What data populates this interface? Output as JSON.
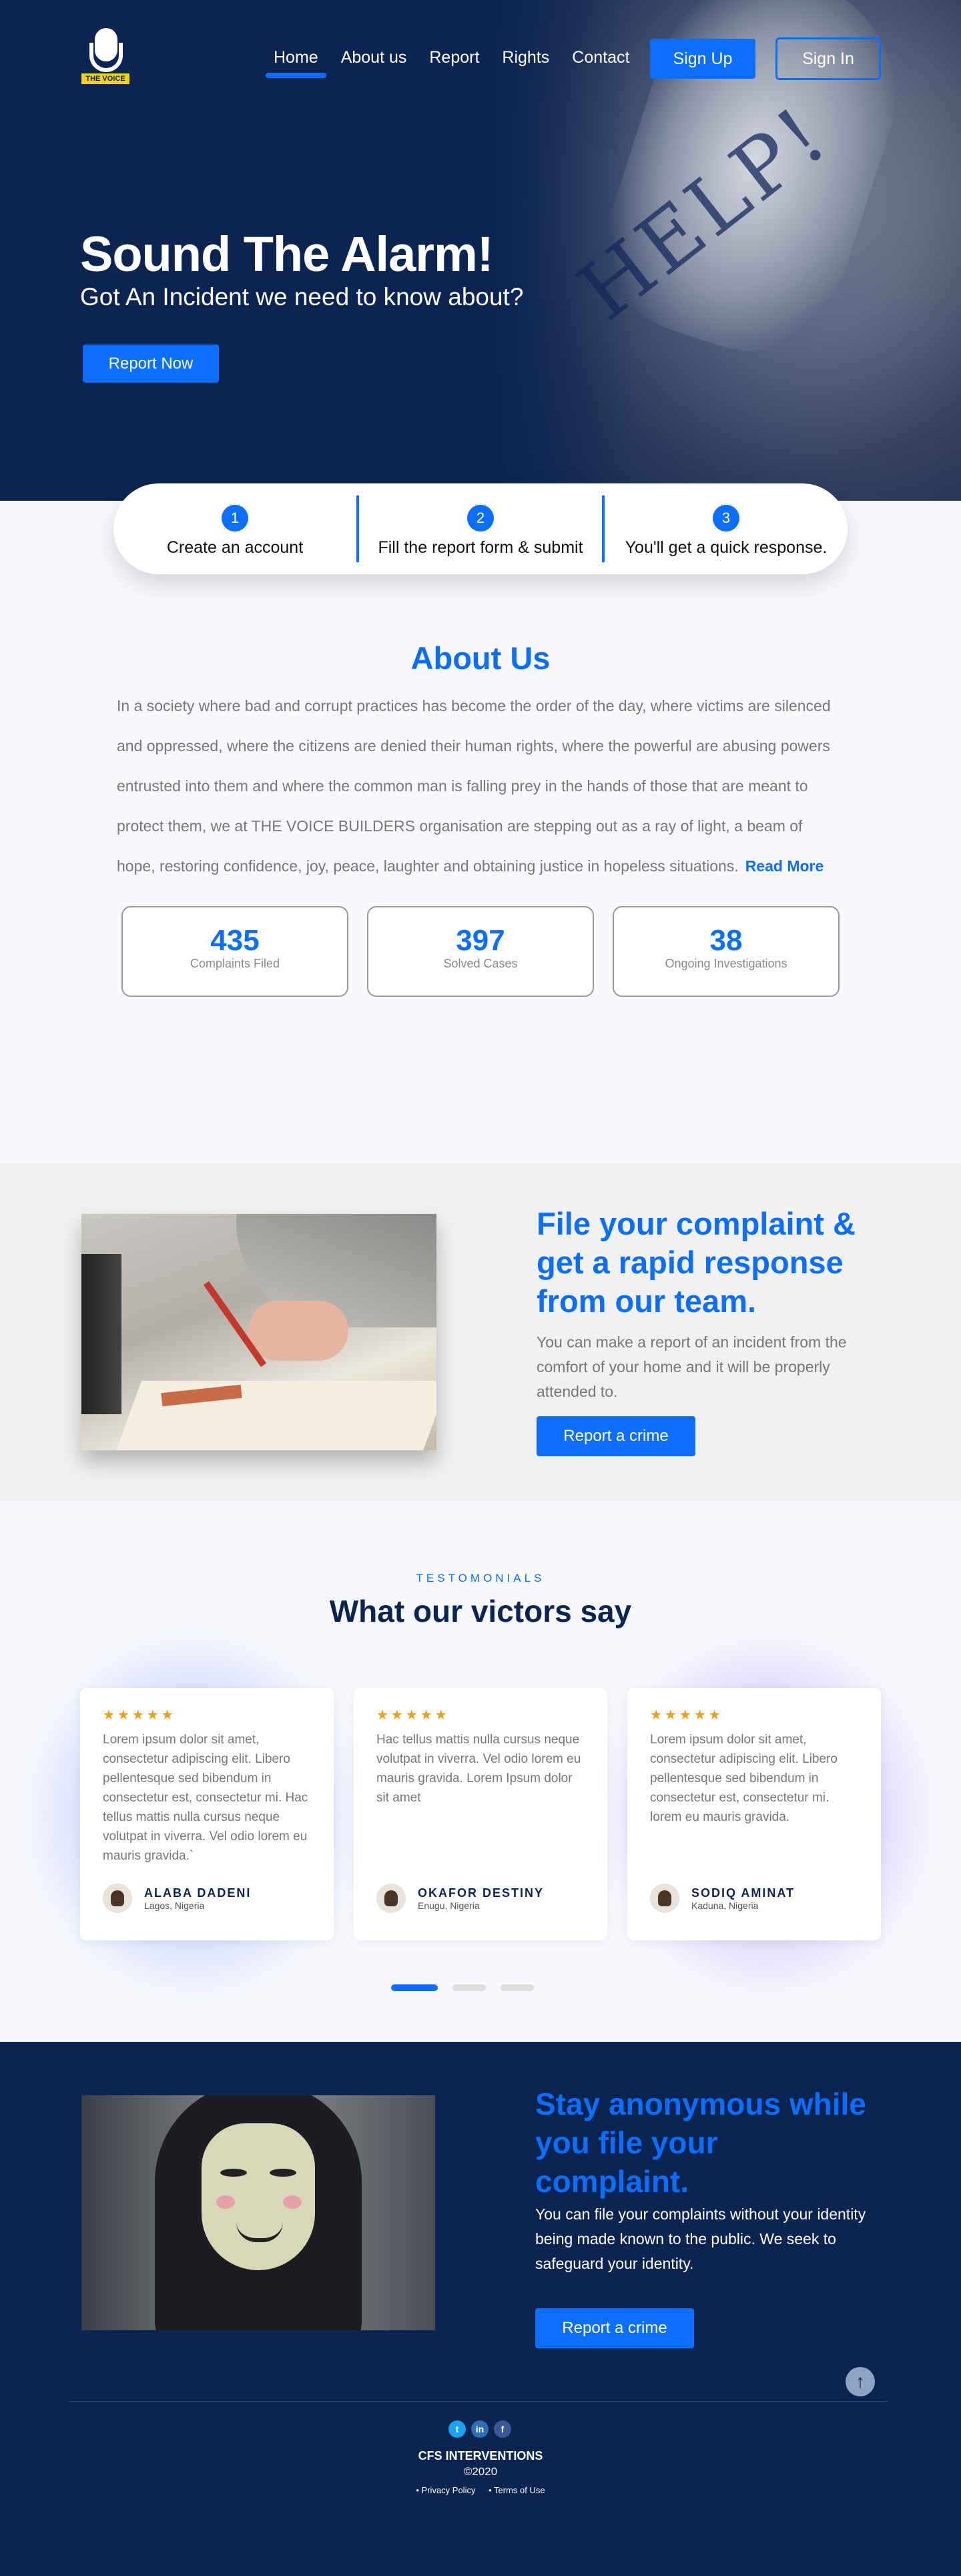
{
  "brand": {
    "logo_text": "THE VOICE"
  },
  "nav": {
    "items": [
      {
        "label": "Home"
      },
      {
        "label": "About us"
      },
      {
        "label": "Report"
      },
      {
        "label": "Rights"
      },
      {
        "label": "Contact"
      }
    ],
    "active_index": 0,
    "signup_label": "Sign Up",
    "signin_label": "Sign In"
  },
  "hero": {
    "title": "Sound The Alarm!",
    "subtitle": "Got An Incident we need to know about?",
    "cta_label": "Report Now",
    "image_text": "HELP!"
  },
  "steps": [
    {
      "number": "1",
      "label": "Create an account"
    },
    {
      "number": "2",
      "label": "Fill the report form & submit"
    },
    {
      "number": "3",
      "label": "You'll get a quick response."
    }
  ],
  "about": {
    "title": "About Us",
    "text": "In a society where bad and corrupt practices has become the order of the day, where victims are silenced and oppressed, where the citizens are denied their human rights, where the powerful are abusing powers entrusted into them and where the common man is falling prey in the hands of those that are meant to protect them, we at THE VOICE BUILDERS organisation are stepping out as a ray of light, a beam of hope, restoring confidence, joy, peace, laughter and obtaining justice in hopeless situations.",
    "read_more": "Read More",
    "stats": [
      {
        "value": "435",
        "label": "Complaints Filed"
      },
      {
        "value": "397",
        "label": "Solved Cases"
      },
      {
        "value": "38",
        "label": "Ongoing Investigations"
      }
    ]
  },
  "complaint": {
    "title": "File your complaint & get a rapid response from our team.",
    "text": "You can make a report of an incident from the comfort of your home and it will be properly attended to.",
    "cta_label": "Report a crime"
  },
  "testimonials": {
    "eyebrow": "TESTOMONIALS",
    "title": "What our victors say",
    "cards": [
      {
        "stars": "★★★★★",
        "text": "Lorem ipsum dolor sit amet, consectetur adipiscing elit. Libero pellentesque sed bibendum in consectetur est, consectetur mi. Hac tellus mattis nulla cursus neque volutpat in viverra. Vel odio lorem eu mauris gravida.`",
        "name": "ALABA DADENI",
        "location": "Lagos, Nigeria"
      },
      {
        "stars": "★★★★★",
        "text": " Hac tellus mattis nulla cursus neque volutpat in viverra. Vel odio lorem eu mauris gravida. Lorem Ipsum dolor sit amet",
        "name": "OKAFOR DESTINY",
        "location": "Enugu, Nigeria"
      },
      {
        "stars": "★★★★★",
        "text": "Lorem ipsum dolor sit amet, consectetur adipiscing elit. Libero pellentesque sed bibendum in consectetur est, consectetur mi. lorem eu mauris gravida.",
        "name": "SODIQ AMINAT",
        "location": "Kaduna, Nigeria"
      }
    ],
    "active_slide": 0
  },
  "anonymous": {
    "title": "Stay anonymous while you file your complaint.",
    "text": "You can file your complaints without your identity being made known to the public. We seek to safeguard your identity.",
    "cta_label": "Report a crime"
  },
  "footer": {
    "name": "CFS INTERVENTIONS",
    "year": "©2020",
    "links": [
      "• Privacy Policy",
      "• Terms of Use"
    ],
    "socials": [
      "twitter-icon",
      "linkedin-icon",
      "facebook-icon"
    ]
  },
  "colors": {
    "primary": "#0d6efd",
    "navy": "#0b2452",
    "star": "#f39c12"
  }
}
